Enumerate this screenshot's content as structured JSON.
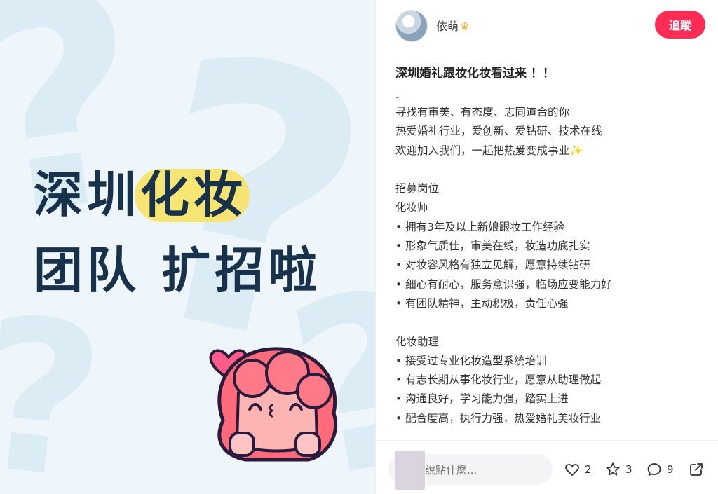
{
  "cover": {
    "headline_line1_a": "深圳",
    "headline_line1_b": "化妆",
    "headline_line2": "团队 扩招啦",
    "accent_color": "#f7e46b",
    "text_color": "#17324a"
  },
  "author": {
    "name": "依萌",
    "badge_icon": "crown-icon"
  },
  "follow_label": "追蹤",
  "post": {
    "title": "深圳婚礼跟妆化妆看过来 ！！",
    "lines": [
      "-",
      "寻找有审美、有态度、志同道合的你",
      "热爱婚礼行业，爱创新、爱钻研、技术在线",
      "欢迎加入我们，一起把热爱变成事业✨",
      "",
      "招募岗位",
      "化妆师",
      "• 拥有3年及以上新娘跟妆工作经验",
      "• 形象气质佳，审美在线，妆造功底扎实",
      "• 对妆容风格有独立见解，愿意持续钻研",
      "• 细心有耐心，服务意识强，临场应变能力好",
      "• 有团队精神，主动积极，责任心强",
      "",
      "化妆助理",
      "• 接受过专业化妆造型系统培训",
      "• 有志长期从事化妆行业，愿意从助理做起",
      "• 沟通良好，学习能力强，踏实上进",
      "• 配合度高，执行力强，热爱婚礼美妆行业"
    ]
  },
  "comment_placeholder": "說點什麼...",
  "actions": {
    "likes": "2",
    "stars": "3",
    "comments": "9"
  }
}
